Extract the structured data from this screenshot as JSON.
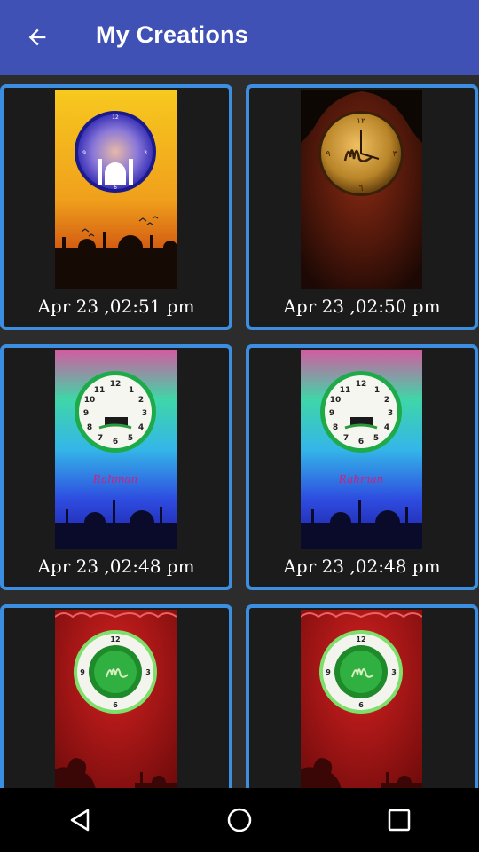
{
  "app_bar": {
    "title": "My Creations",
    "back_icon": "arrow-back-icon",
    "background": "#3f51b5"
  },
  "creations": [
    {
      "timestamp": "Apr 23 ,02:51 pm",
      "thumbnail": "photo-clock-mosque-sunset"
    },
    {
      "timestamp": "Apr 23 ,02:50 pm",
      "thumbnail": "gold-allah-clock-wood"
    },
    {
      "timestamp": "Apr 23 ,02:48 pm",
      "thumbnail": "green-clock-rainbow-mosque",
      "label": "Rahman"
    },
    {
      "timestamp": "Apr 23 ,02:48 pm",
      "thumbnail": "green-clock-rainbow-mosque",
      "label": "Rahman"
    },
    {
      "timestamp": "",
      "thumbnail": "green-clock-red-prayer"
    },
    {
      "timestamp": "",
      "thumbnail": "green-clock-red-prayer"
    }
  ],
  "card_border_color": "#3b8ee0",
  "nav_bar": {
    "back_icon": "triangle-back-icon",
    "home_icon": "circle-home-icon",
    "recents_icon": "square-recents-icon"
  }
}
